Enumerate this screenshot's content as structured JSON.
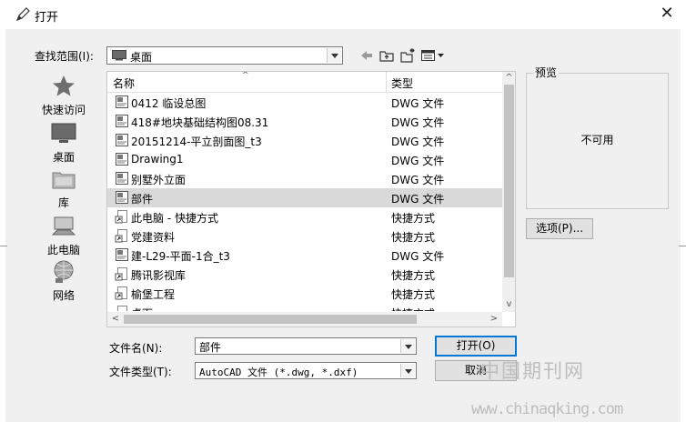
{
  "window": {
    "title": "打开",
    "close_glyph": "✕"
  },
  "lookin": {
    "label": "查找范围(I):",
    "value": "桌面"
  },
  "places": [
    {
      "label": "快速访问",
      "icon": "star-icon"
    },
    {
      "label": "桌面",
      "icon": "desktop-icon"
    },
    {
      "label": "库",
      "icon": "library-icon"
    },
    {
      "label": "此电脑",
      "icon": "computer-icon"
    },
    {
      "label": "网络",
      "icon": "network-icon"
    }
  ],
  "list": {
    "col_name": "名称",
    "col_type": "类型",
    "rows": [
      {
        "name": "0412  临设总图",
        "type": "DWG 文件",
        "icon": "dwg-file-icon",
        "selected": false
      },
      {
        "name": "418#地块基础结构图08.31",
        "type": "DWG 文件",
        "icon": "dwg-file-icon",
        "selected": false
      },
      {
        "name": "20151214-平立剖面图_t3",
        "type": "DWG 文件",
        "icon": "dwg-file-icon",
        "selected": false
      },
      {
        "name": "Drawing1",
        "type": "DWG 文件",
        "icon": "dwg-file-icon",
        "selected": false
      },
      {
        "name": "别墅外立面",
        "type": "DWG 文件",
        "icon": "dwg-file-icon",
        "selected": false
      },
      {
        "name": "部件",
        "type": "DWG 文件",
        "icon": "dwg-file-icon",
        "selected": true
      },
      {
        "name": "此电脑 - 快捷方式",
        "type": "快捷方式",
        "icon": "shortcut-icon",
        "selected": false
      },
      {
        "name": "党建资料",
        "type": "快捷方式",
        "icon": "shortcut-icon",
        "selected": false
      },
      {
        "name": "建-L29-平面-1合_t3",
        "type": "DWG 文件",
        "icon": "dwg-file-icon",
        "selected": false
      },
      {
        "name": "腾讯影视库",
        "type": "快捷方式",
        "icon": "shortcut-icon",
        "selected": false
      },
      {
        "name": "榆堡工程",
        "type": "快捷方式",
        "icon": "shortcut-icon",
        "selected": false
      },
      {
        "name": "桌面",
        "type": "快捷方式",
        "icon": "shortcut-icon",
        "selected": false
      }
    ]
  },
  "preview": {
    "title": "预览",
    "text": "不可用"
  },
  "options_button": "选项(P)...",
  "filename": {
    "label": "文件名(N):",
    "value": "部件"
  },
  "filetype": {
    "label": "文件类型(T):",
    "value": "AutoCAD 文件 (*.dwg, *.dxf)"
  },
  "open_button": "打开(O)",
  "cancel_button": "取消",
  "watermark": {
    "line1": "中国期刊网",
    "line2": "www.chinaqking.com"
  }
}
